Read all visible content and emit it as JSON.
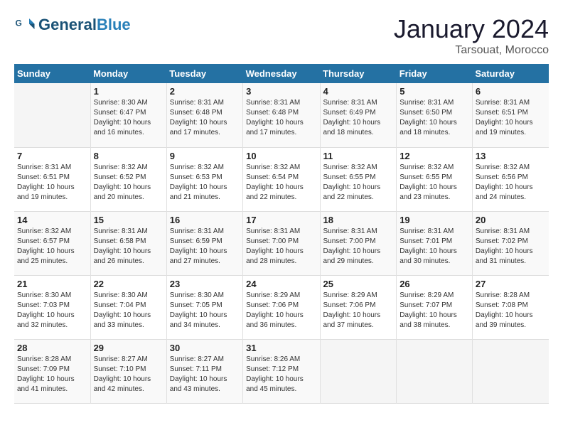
{
  "header": {
    "logo_general": "General",
    "logo_blue": "Blue",
    "month": "January 2024",
    "location": "Tarsouat, Morocco"
  },
  "weekdays": [
    "Sunday",
    "Monday",
    "Tuesday",
    "Wednesday",
    "Thursday",
    "Friday",
    "Saturday"
  ],
  "weeks": [
    [
      {
        "day": "",
        "sunrise": "",
        "sunset": "",
        "daylight": ""
      },
      {
        "day": "1",
        "sunrise": "Sunrise: 8:30 AM",
        "sunset": "Sunset: 6:47 PM",
        "daylight": "Daylight: 10 hours and 16 minutes."
      },
      {
        "day": "2",
        "sunrise": "Sunrise: 8:31 AM",
        "sunset": "Sunset: 6:48 PM",
        "daylight": "Daylight: 10 hours and 17 minutes."
      },
      {
        "day": "3",
        "sunrise": "Sunrise: 8:31 AM",
        "sunset": "Sunset: 6:48 PM",
        "daylight": "Daylight: 10 hours and 17 minutes."
      },
      {
        "day": "4",
        "sunrise": "Sunrise: 8:31 AM",
        "sunset": "Sunset: 6:49 PM",
        "daylight": "Daylight: 10 hours and 18 minutes."
      },
      {
        "day": "5",
        "sunrise": "Sunrise: 8:31 AM",
        "sunset": "Sunset: 6:50 PM",
        "daylight": "Daylight: 10 hours and 18 minutes."
      },
      {
        "day": "6",
        "sunrise": "Sunrise: 8:31 AM",
        "sunset": "Sunset: 6:51 PM",
        "daylight": "Daylight: 10 hours and 19 minutes."
      }
    ],
    [
      {
        "day": "7",
        "sunrise": "Sunrise: 8:31 AM",
        "sunset": "Sunset: 6:51 PM",
        "daylight": "Daylight: 10 hours and 19 minutes."
      },
      {
        "day": "8",
        "sunrise": "Sunrise: 8:32 AM",
        "sunset": "Sunset: 6:52 PM",
        "daylight": "Daylight: 10 hours and 20 minutes."
      },
      {
        "day": "9",
        "sunrise": "Sunrise: 8:32 AM",
        "sunset": "Sunset: 6:53 PM",
        "daylight": "Daylight: 10 hours and 21 minutes."
      },
      {
        "day": "10",
        "sunrise": "Sunrise: 8:32 AM",
        "sunset": "Sunset: 6:54 PM",
        "daylight": "Daylight: 10 hours and 22 minutes."
      },
      {
        "day": "11",
        "sunrise": "Sunrise: 8:32 AM",
        "sunset": "Sunset: 6:55 PM",
        "daylight": "Daylight: 10 hours and 22 minutes."
      },
      {
        "day": "12",
        "sunrise": "Sunrise: 8:32 AM",
        "sunset": "Sunset: 6:55 PM",
        "daylight": "Daylight: 10 hours and 23 minutes."
      },
      {
        "day": "13",
        "sunrise": "Sunrise: 8:32 AM",
        "sunset": "Sunset: 6:56 PM",
        "daylight": "Daylight: 10 hours and 24 minutes."
      }
    ],
    [
      {
        "day": "14",
        "sunrise": "Sunrise: 8:32 AM",
        "sunset": "Sunset: 6:57 PM",
        "daylight": "Daylight: 10 hours and 25 minutes."
      },
      {
        "day": "15",
        "sunrise": "Sunrise: 8:31 AM",
        "sunset": "Sunset: 6:58 PM",
        "daylight": "Daylight: 10 hours and 26 minutes."
      },
      {
        "day": "16",
        "sunrise": "Sunrise: 8:31 AM",
        "sunset": "Sunset: 6:59 PM",
        "daylight": "Daylight: 10 hours and 27 minutes."
      },
      {
        "day": "17",
        "sunrise": "Sunrise: 8:31 AM",
        "sunset": "Sunset: 7:00 PM",
        "daylight": "Daylight: 10 hours and 28 minutes."
      },
      {
        "day": "18",
        "sunrise": "Sunrise: 8:31 AM",
        "sunset": "Sunset: 7:00 PM",
        "daylight": "Daylight: 10 hours and 29 minutes."
      },
      {
        "day": "19",
        "sunrise": "Sunrise: 8:31 AM",
        "sunset": "Sunset: 7:01 PM",
        "daylight": "Daylight: 10 hours and 30 minutes."
      },
      {
        "day": "20",
        "sunrise": "Sunrise: 8:31 AM",
        "sunset": "Sunset: 7:02 PM",
        "daylight": "Daylight: 10 hours and 31 minutes."
      }
    ],
    [
      {
        "day": "21",
        "sunrise": "Sunrise: 8:30 AM",
        "sunset": "Sunset: 7:03 PM",
        "daylight": "Daylight: 10 hours and 32 minutes."
      },
      {
        "day": "22",
        "sunrise": "Sunrise: 8:30 AM",
        "sunset": "Sunset: 7:04 PM",
        "daylight": "Daylight: 10 hours and 33 minutes."
      },
      {
        "day": "23",
        "sunrise": "Sunrise: 8:30 AM",
        "sunset": "Sunset: 7:05 PM",
        "daylight": "Daylight: 10 hours and 34 minutes."
      },
      {
        "day": "24",
        "sunrise": "Sunrise: 8:29 AM",
        "sunset": "Sunset: 7:06 PM",
        "daylight": "Daylight: 10 hours and 36 minutes."
      },
      {
        "day": "25",
        "sunrise": "Sunrise: 8:29 AM",
        "sunset": "Sunset: 7:06 PM",
        "daylight": "Daylight: 10 hours and 37 minutes."
      },
      {
        "day": "26",
        "sunrise": "Sunrise: 8:29 AM",
        "sunset": "Sunset: 7:07 PM",
        "daylight": "Daylight: 10 hours and 38 minutes."
      },
      {
        "day": "27",
        "sunrise": "Sunrise: 8:28 AM",
        "sunset": "Sunset: 7:08 PM",
        "daylight": "Daylight: 10 hours and 39 minutes."
      }
    ],
    [
      {
        "day": "28",
        "sunrise": "Sunrise: 8:28 AM",
        "sunset": "Sunset: 7:09 PM",
        "daylight": "Daylight: 10 hours and 41 minutes."
      },
      {
        "day": "29",
        "sunrise": "Sunrise: 8:27 AM",
        "sunset": "Sunset: 7:10 PM",
        "daylight": "Daylight: 10 hours and 42 minutes."
      },
      {
        "day": "30",
        "sunrise": "Sunrise: 8:27 AM",
        "sunset": "Sunset: 7:11 PM",
        "daylight": "Daylight: 10 hours and 43 minutes."
      },
      {
        "day": "31",
        "sunrise": "Sunrise: 8:26 AM",
        "sunset": "Sunset: 7:12 PM",
        "daylight": "Daylight: 10 hours and 45 minutes."
      },
      {
        "day": "",
        "sunrise": "",
        "sunset": "",
        "daylight": ""
      },
      {
        "day": "",
        "sunrise": "",
        "sunset": "",
        "daylight": ""
      },
      {
        "day": "",
        "sunrise": "",
        "sunset": "",
        "daylight": ""
      }
    ]
  ]
}
